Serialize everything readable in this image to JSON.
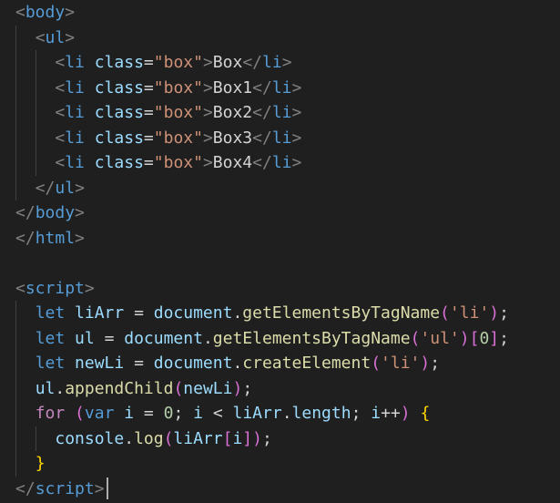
{
  "code": {
    "lines": [
      [
        {
          "t": "<",
          "c": "punct"
        },
        {
          "t": "body",
          "c": "tag"
        },
        {
          "t": ">",
          "c": "punct"
        }
      ],
      [
        {
          "t": "  ",
          "c": "text"
        },
        {
          "t": "<",
          "c": "punct"
        },
        {
          "t": "ul",
          "c": "tag"
        },
        {
          "t": ">",
          "c": "punct"
        }
      ],
      [
        {
          "t": "    ",
          "c": "text"
        },
        {
          "t": "<",
          "c": "punct"
        },
        {
          "t": "li",
          "c": "tag"
        },
        {
          "t": " ",
          "c": "text"
        },
        {
          "t": "class",
          "c": "attr"
        },
        {
          "t": "=",
          "c": "text"
        },
        {
          "t": "\"box\"",
          "c": "str"
        },
        {
          "t": ">",
          "c": "punct"
        },
        {
          "t": "Box",
          "c": "text"
        },
        {
          "t": "</",
          "c": "punct"
        },
        {
          "t": "li",
          "c": "tag"
        },
        {
          "t": ">",
          "c": "punct"
        }
      ],
      [
        {
          "t": "    ",
          "c": "text"
        },
        {
          "t": "<",
          "c": "punct"
        },
        {
          "t": "li",
          "c": "tag"
        },
        {
          "t": " ",
          "c": "text"
        },
        {
          "t": "class",
          "c": "attr"
        },
        {
          "t": "=",
          "c": "text"
        },
        {
          "t": "\"box\"",
          "c": "str"
        },
        {
          "t": ">",
          "c": "punct"
        },
        {
          "t": "Box1",
          "c": "text"
        },
        {
          "t": "</",
          "c": "punct"
        },
        {
          "t": "li",
          "c": "tag"
        },
        {
          "t": ">",
          "c": "punct"
        }
      ],
      [
        {
          "t": "    ",
          "c": "text"
        },
        {
          "t": "<",
          "c": "punct"
        },
        {
          "t": "li",
          "c": "tag"
        },
        {
          "t": " ",
          "c": "text"
        },
        {
          "t": "class",
          "c": "attr"
        },
        {
          "t": "=",
          "c": "text"
        },
        {
          "t": "\"box\"",
          "c": "str"
        },
        {
          "t": ">",
          "c": "punct"
        },
        {
          "t": "Box2",
          "c": "text"
        },
        {
          "t": "</",
          "c": "punct"
        },
        {
          "t": "li",
          "c": "tag"
        },
        {
          "t": ">",
          "c": "punct"
        }
      ],
      [
        {
          "t": "    ",
          "c": "text"
        },
        {
          "t": "<",
          "c": "punct"
        },
        {
          "t": "li",
          "c": "tag"
        },
        {
          "t": " ",
          "c": "text"
        },
        {
          "t": "class",
          "c": "attr"
        },
        {
          "t": "=",
          "c": "text"
        },
        {
          "t": "\"box\"",
          "c": "str"
        },
        {
          "t": ">",
          "c": "punct"
        },
        {
          "t": "Box3",
          "c": "text"
        },
        {
          "t": "</",
          "c": "punct"
        },
        {
          "t": "li",
          "c": "tag"
        },
        {
          "t": ">",
          "c": "punct"
        }
      ],
      [
        {
          "t": "    ",
          "c": "text"
        },
        {
          "t": "<",
          "c": "punct"
        },
        {
          "t": "li",
          "c": "tag"
        },
        {
          "t": " ",
          "c": "text"
        },
        {
          "t": "class",
          "c": "attr"
        },
        {
          "t": "=",
          "c": "text"
        },
        {
          "t": "\"box\"",
          "c": "str"
        },
        {
          "t": ">",
          "c": "punct"
        },
        {
          "t": "Box4",
          "c": "text"
        },
        {
          "t": "</",
          "c": "punct"
        },
        {
          "t": "li",
          "c": "tag"
        },
        {
          "t": ">",
          "c": "punct"
        }
      ],
      [
        {
          "t": "  ",
          "c": "text"
        },
        {
          "t": "</",
          "c": "punct"
        },
        {
          "t": "ul",
          "c": "tag"
        },
        {
          "t": ">",
          "c": "punct"
        }
      ],
      [
        {
          "t": "</",
          "c": "punct"
        },
        {
          "t": "body",
          "c": "tag"
        },
        {
          "t": ">",
          "c": "punct"
        }
      ],
      [
        {
          "t": "</",
          "c": "punct"
        },
        {
          "t": "html",
          "c": "tag"
        },
        {
          "t": ">",
          "c": "punct"
        }
      ],
      [],
      [
        {
          "t": "<",
          "c": "punct"
        },
        {
          "t": "script",
          "c": "tag"
        },
        {
          "t": ">",
          "c": "punct"
        }
      ],
      [
        {
          "t": "  ",
          "c": "text"
        },
        {
          "t": "let",
          "c": "kw"
        },
        {
          "t": " ",
          "c": "text"
        },
        {
          "t": "liArr",
          "c": "var"
        },
        {
          "t": " = ",
          "c": "op"
        },
        {
          "t": "document",
          "c": "var"
        },
        {
          "t": ".",
          "c": "op"
        },
        {
          "t": "getElementsByTagName",
          "c": "fn"
        },
        {
          "t": "(",
          "c": "paren"
        },
        {
          "t": "'li'",
          "c": "str"
        },
        {
          "t": ")",
          "c": "paren"
        },
        {
          "t": ";",
          "c": "op"
        }
      ],
      [
        {
          "t": "  ",
          "c": "text"
        },
        {
          "t": "let",
          "c": "kw"
        },
        {
          "t": " ",
          "c": "text"
        },
        {
          "t": "ul",
          "c": "var"
        },
        {
          "t": " = ",
          "c": "op"
        },
        {
          "t": "document",
          "c": "var"
        },
        {
          "t": ".",
          "c": "op"
        },
        {
          "t": "getElementsByTagName",
          "c": "fn"
        },
        {
          "t": "(",
          "c": "paren"
        },
        {
          "t": "'ul'",
          "c": "str"
        },
        {
          "t": ")",
          "c": "paren"
        },
        {
          "t": "[",
          "c": "paren"
        },
        {
          "t": "0",
          "c": "num"
        },
        {
          "t": "]",
          "c": "paren"
        },
        {
          "t": ";",
          "c": "op"
        }
      ],
      [
        {
          "t": "  ",
          "c": "text"
        },
        {
          "t": "let",
          "c": "kw"
        },
        {
          "t": " ",
          "c": "text"
        },
        {
          "t": "newLi",
          "c": "var"
        },
        {
          "t": " = ",
          "c": "op"
        },
        {
          "t": "document",
          "c": "var"
        },
        {
          "t": ".",
          "c": "op"
        },
        {
          "t": "createElement",
          "c": "fn"
        },
        {
          "t": "(",
          "c": "paren"
        },
        {
          "t": "'li'",
          "c": "str"
        },
        {
          "t": ")",
          "c": "paren"
        },
        {
          "t": ";",
          "c": "op"
        }
      ],
      [
        {
          "t": "  ",
          "c": "text"
        },
        {
          "t": "ul",
          "c": "var"
        },
        {
          "t": ".",
          "c": "op"
        },
        {
          "t": "appendChild",
          "c": "fn"
        },
        {
          "t": "(",
          "c": "paren"
        },
        {
          "t": "newLi",
          "c": "var"
        },
        {
          "t": ")",
          "c": "paren"
        },
        {
          "t": ";",
          "c": "op"
        }
      ],
      [
        {
          "t": "  ",
          "c": "text"
        },
        {
          "t": "for",
          "c": "ctrl"
        },
        {
          "t": " ",
          "c": "text"
        },
        {
          "t": "(",
          "c": "paren"
        },
        {
          "t": "var",
          "c": "kw"
        },
        {
          "t": " ",
          "c": "text"
        },
        {
          "t": "i",
          "c": "var"
        },
        {
          "t": " = ",
          "c": "op"
        },
        {
          "t": "0",
          "c": "num"
        },
        {
          "t": "; ",
          "c": "op"
        },
        {
          "t": "i",
          "c": "var"
        },
        {
          "t": " < ",
          "c": "op"
        },
        {
          "t": "liArr",
          "c": "var"
        },
        {
          "t": ".",
          "c": "op"
        },
        {
          "t": "length",
          "c": "var"
        },
        {
          "t": "; ",
          "c": "op"
        },
        {
          "t": "i",
          "c": "var"
        },
        {
          "t": "++",
          "c": "op"
        },
        {
          "t": ")",
          "c": "paren"
        },
        {
          "t": " ",
          "c": "text"
        },
        {
          "t": "{",
          "c": "brace"
        }
      ],
      [
        {
          "t": "    ",
          "c": "text"
        },
        {
          "t": "console",
          "c": "var"
        },
        {
          "t": ".",
          "c": "op"
        },
        {
          "t": "log",
          "c": "fn"
        },
        {
          "t": "(",
          "c": "paren"
        },
        {
          "t": "liArr",
          "c": "var"
        },
        {
          "t": "[",
          "c": "paren"
        },
        {
          "t": "i",
          "c": "var"
        },
        {
          "t": "]",
          "c": "paren"
        },
        {
          "t": ")",
          "c": "paren"
        },
        {
          "t": ";",
          "c": "op"
        }
      ],
      [
        {
          "t": "  ",
          "c": "text"
        },
        {
          "t": "}",
          "c": "brace"
        }
      ],
      [
        {
          "t": "</",
          "c": "punct"
        },
        {
          "t": "script",
          "c": "tag"
        },
        {
          "t": ">",
          "c": "punct"
        }
      ]
    ]
  }
}
